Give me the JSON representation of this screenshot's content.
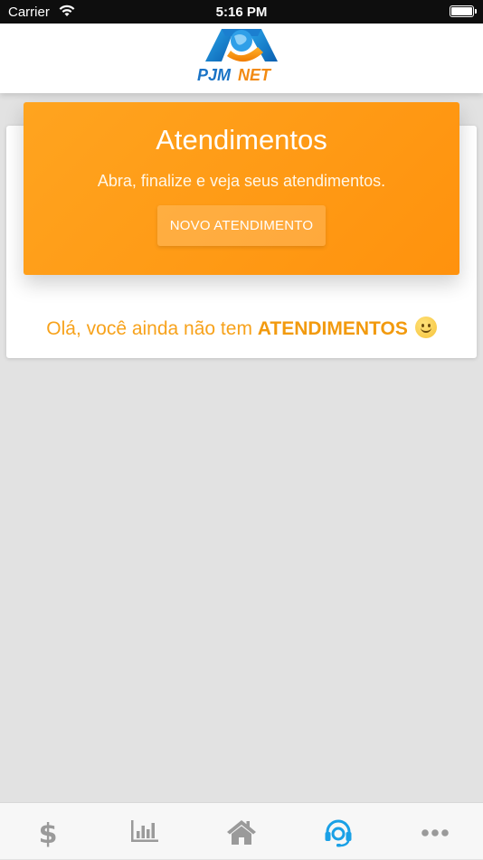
{
  "status_bar": {
    "carrier": "Carrier",
    "time": "5:16 PM"
  },
  "header": {
    "logo_text": "PJMNET"
  },
  "hero": {
    "title": "Atendimentos",
    "subtitle": "Abra, finalize e veja seus atendimentos.",
    "button_label": "NOVO ATENDIMENTO"
  },
  "empty_state": {
    "prefix": "Olá, você ainda não tem ",
    "highlight": "ATENDIMENTOS"
  },
  "tab_bar": {
    "tabs": [
      {
        "icon": "dollar-icon",
        "active": false
      },
      {
        "icon": "bar-chart-icon",
        "active": false
      },
      {
        "icon": "home-icon",
        "active": false
      },
      {
        "icon": "headset-icon",
        "active": true
      },
      {
        "icon": "more-icon",
        "active": false
      }
    ],
    "active_color": "#1aa0e6",
    "inactive_color": "#9a9a9a"
  },
  "colors": {
    "accent": "#ff9a12",
    "background": "#e2e2e2"
  }
}
